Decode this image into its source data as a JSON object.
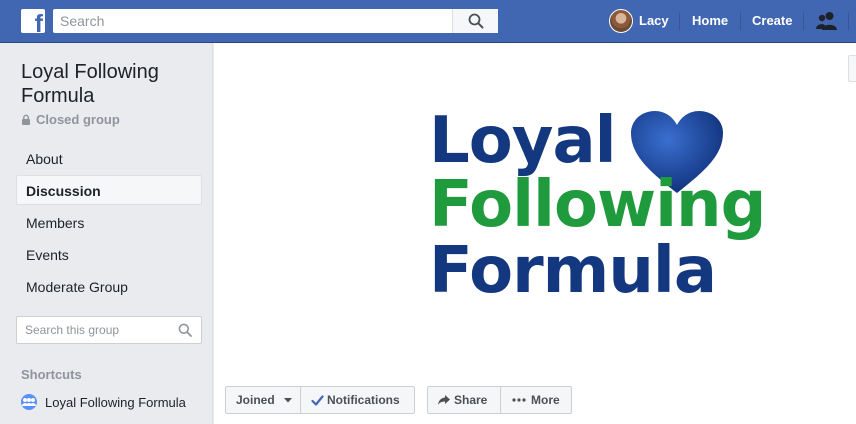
{
  "topbar": {
    "logo_letter": "f",
    "search_placeholder": "Search",
    "user_name": "Lacy",
    "home_label": "Home",
    "create_label": "Create"
  },
  "group": {
    "title": "Loyal Following Formula",
    "privacy": "Closed group",
    "logo_lines": [
      "Loyal",
      "Following",
      "Formula"
    ]
  },
  "left_nav": {
    "items": [
      {
        "label": "About"
      },
      {
        "label": "Discussion",
        "active": true
      },
      {
        "label": "Members"
      },
      {
        "label": "Events"
      },
      {
        "label": "Moderate Group"
      }
    ]
  },
  "group_search": {
    "placeholder": "Search this group"
  },
  "shortcuts": {
    "title": "Shortcuts",
    "items": [
      {
        "label": "Loyal Following Formula"
      }
    ]
  },
  "actions": {
    "joined": "Joined",
    "notifications": "Notifications",
    "share": "Share",
    "more": "More"
  },
  "colors": {
    "brand_blue": "#4267b2",
    "logo_navy": "#14387f",
    "logo_green": "#1f9a3c",
    "check_blue": "#4267b2"
  }
}
